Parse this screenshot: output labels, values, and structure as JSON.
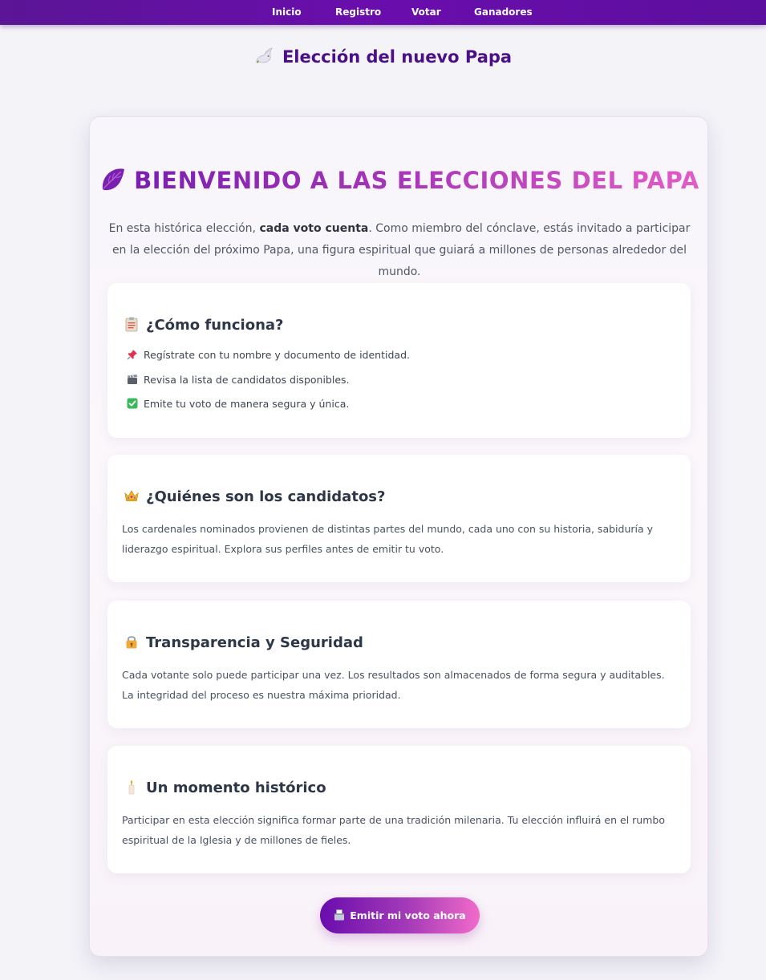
{
  "nav": {
    "items": [
      {
        "label": "Inicio"
      },
      {
        "label": "Registro"
      },
      {
        "label": "Votar"
      },
      {
        "label": "Ganadores"
      }
    ]
  },
  "page": {
    "title": "Elección del nuevo Papa",
    "title_icon": "dove-icon"
  },
  "hero": {
    "icon": "leaf-icon",
    "title": "BIENVENIDO A LAS ELECCIONES DEL PAPA",
    "intro_before": "En esta histórica elección, ",
    "intro_bold": "cada voto cuenta",
    "intro_after": ". Como miembro del cónclave, estás invitado a participar en la elección del próximo Papa, una figura espiritual que guiará a millones de personas alrededor del mundo."
  },
  "sections": {
    "como": {
      "icon": "clipboard-icon",
      "title": "¿Cómo funciona?",
      "steps": [
        {
          "icon": "pushpin-icon",
          "text": "Regístrate con tu nombre y documento de identidad."
        },
        {
          "icon": "clapperboard-icon",
          "text": "Revisa la lista de candidatos disponibles."
        },
        {
          "icon": "check-mark-icon",
          "text": "Emite tu voto de manera segura y única."
        }
      ]
    },
    "candidatos": {
      "icon": "crown-icon",
      "title": "¿Quiénes son los candidatos?",
      "body": "Los cardenales nominados provienen de distintas partes del mundo, cada uno con su historia, sabiduría y liderazgo espiritual. Explora sus perfiles antes de emitir tu voto."
    },
    "transparencia": {
      "icon": "lock-icon",
      "title": "Transparencia y Seguridad",
      "body": "Cada votante solo puede participar una vez. Los resultados son almacenados de forma segura y auditables. La integridad del proceso es nuestra máxima prioridad."
    },
    "momento": {
      "icon": "candle-icon",
      "title": "Un momento histórico",
      "body": "Participar en esta elección significa formar parte de una tradición milenaria. Tu elección influirá en el rumbo espiritual de la Iglesia y de millones de fieles."
    }
  },
  "cta": {
    "icon": "ballot-box-icon",
    "label": "Emitir mi voto ahora"
  },
  "colors": {
    "nav_bg": "#6a0dad",
    "title_purple": "#4b0f86",
    "gradient_start": "#7a1fb0",
    "gradient_end": "#e25cc6",
    "page_bg": "#f4f3f8"
  }
}
